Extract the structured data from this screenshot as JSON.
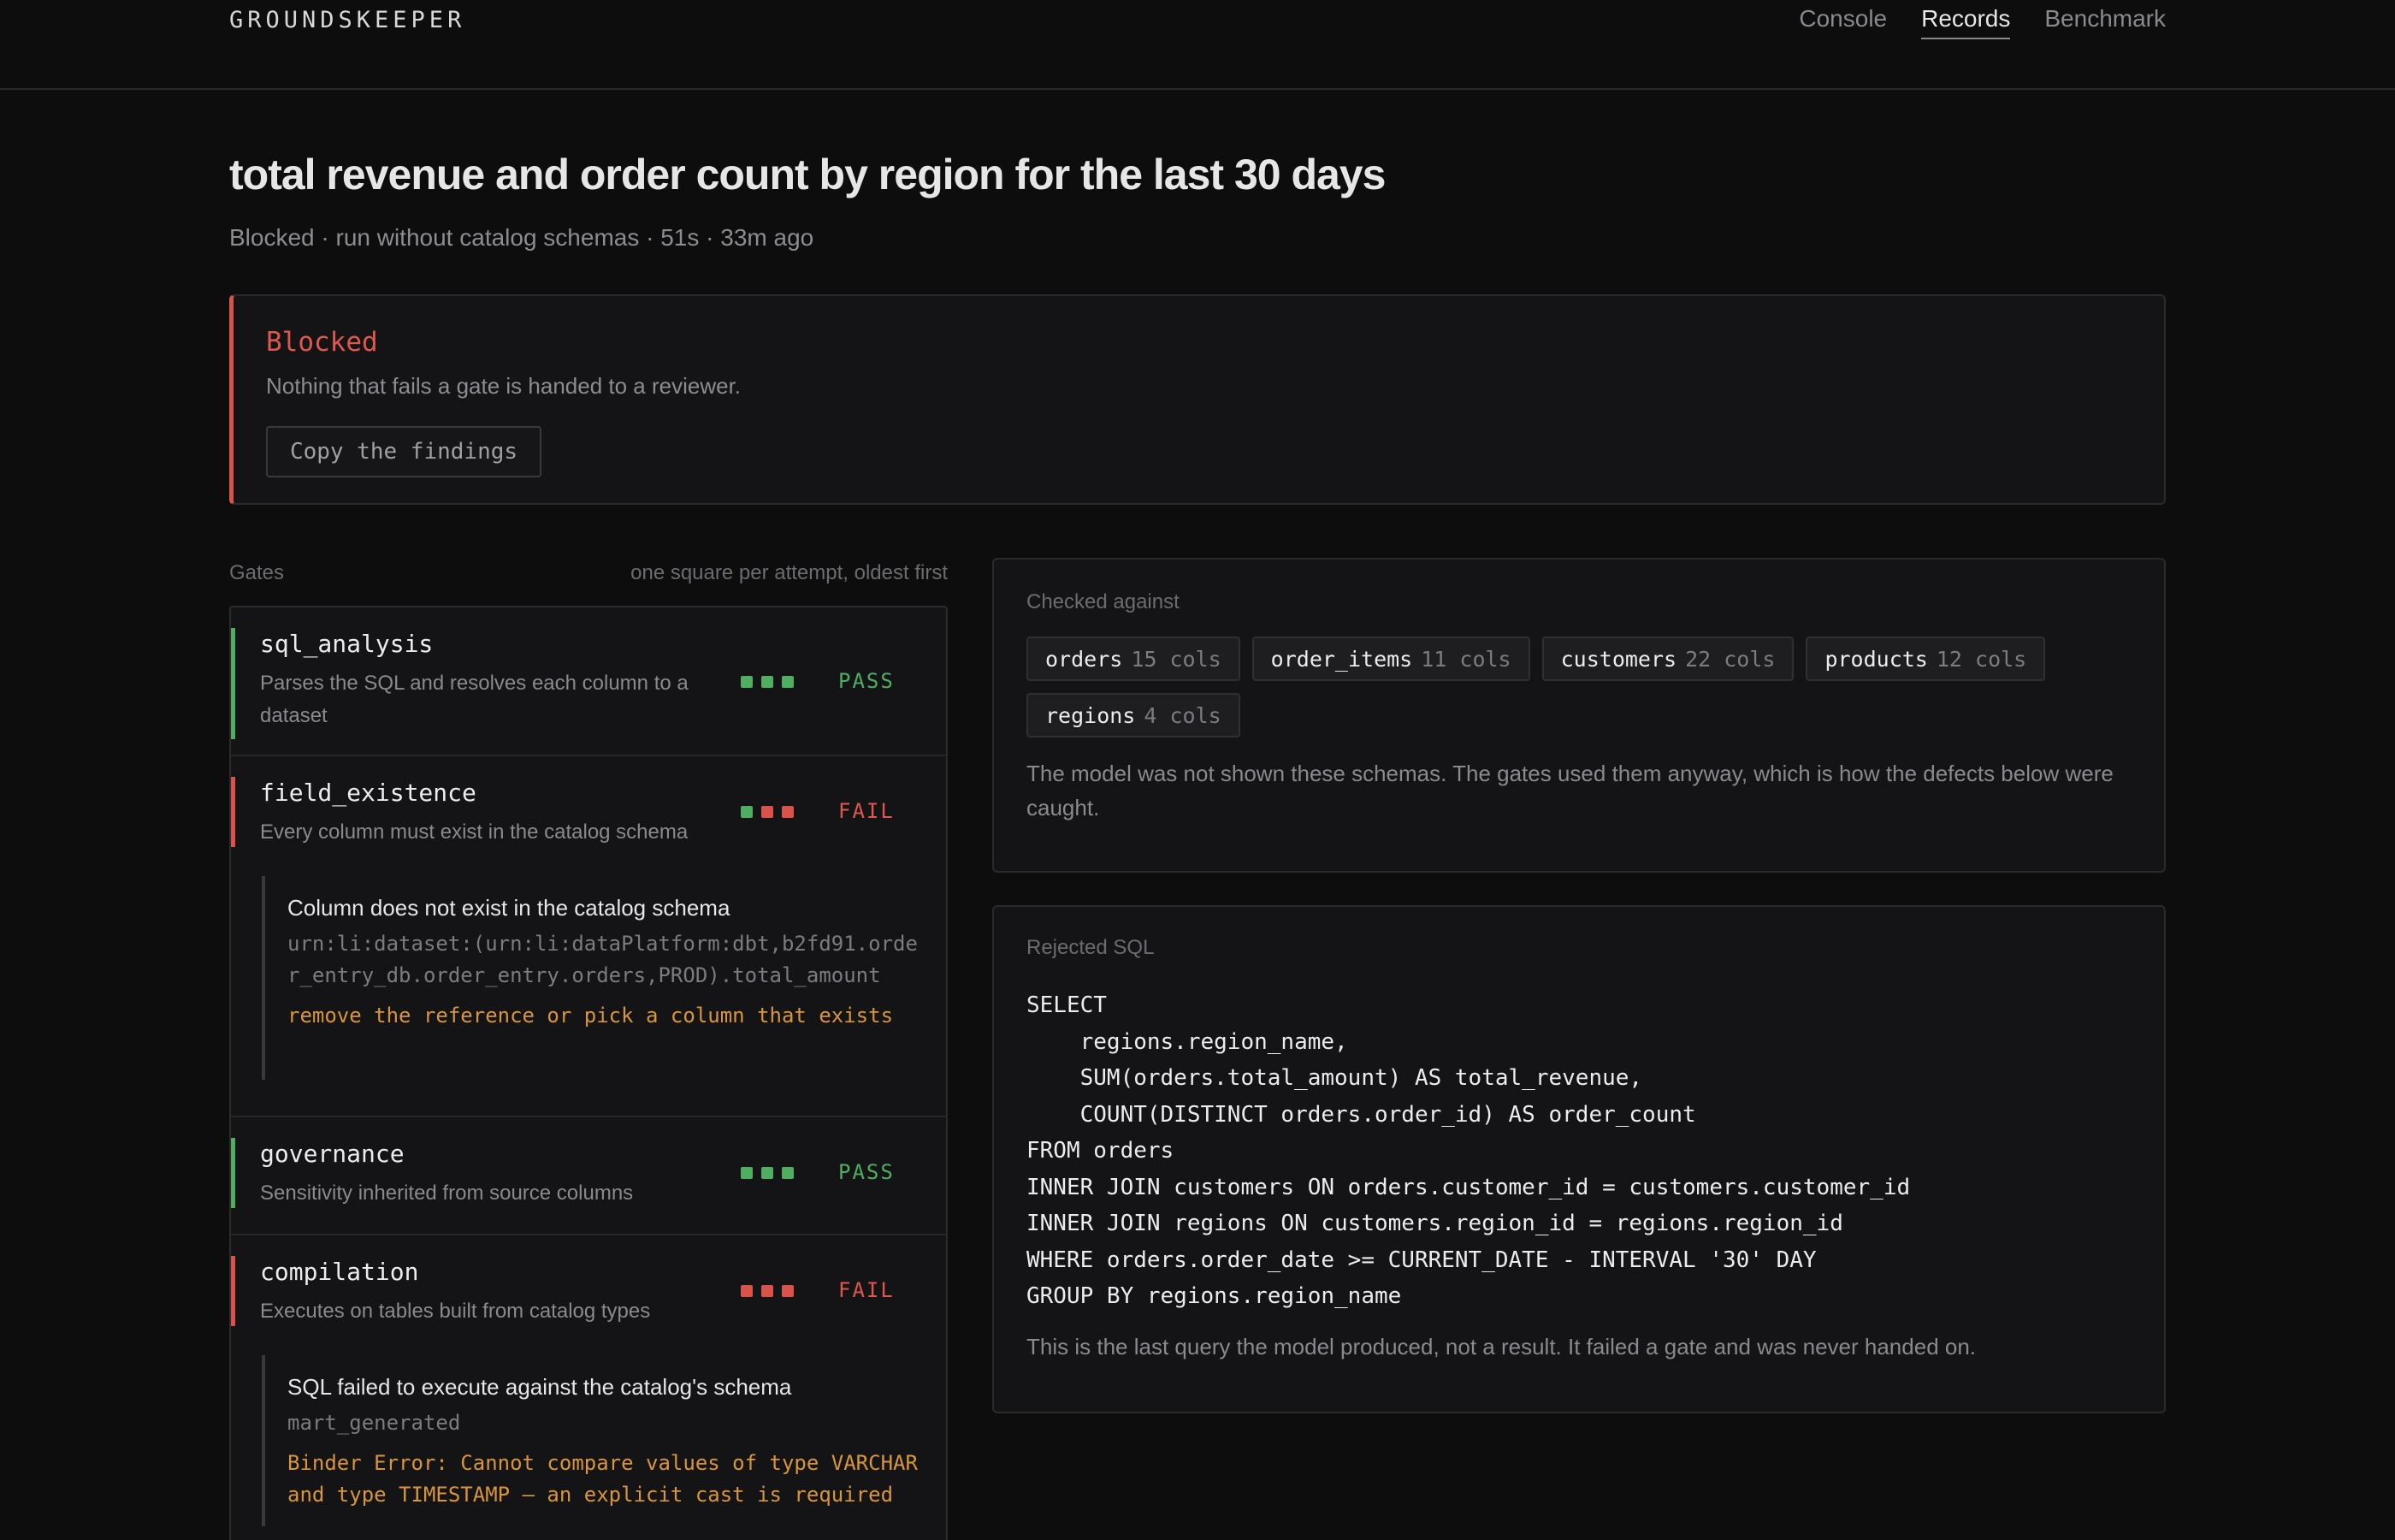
{
  "app": {
    "brand": "GROUNDSKEEPER",
    "nav": [
      "Console",
      "Records",
      "Benchmark"
    ],
    "active_nav": "Records"
  },
  "header": {
    "title": "total revenue and order count by region for the last 30 days",
    "subtitle": "Blocked · run without catalog schemas · 51s · 33m ago"
  },
  "banner": {
    "title": "Blocked",
    "text": "Nothing that fails a gate is handed to a reviewer.",
    "button": "Copy the findings",
    "accent": "#d9534a"
  },
  "gates": {
    "label": "Gates",
    "hint": "one square per attempt, oldest first",
    "items": [
      {
        "name": "sql_analysis",
        "desc": "Parses the SQL and resolves each column to a dataset",
        "attempts": [
          "pass",
          "pass",
          "pass"
        ],
        "status": "PASS"
      },
      {
        "name": "field_existence",
        "desc": "Every column must exist in the catalog schema",
        "attempts": [
          "pass",
          "fail",
          "fail"
        ],
        "status": "FAIL",
        "finding": {
          "title": "Column does not exist in the catalog schema",
          "ref": "urn:li:dataset:(urn:li:dataPlatform:dbt,b2fd91.order_entry_db.order_entry.orders,PROD).total_amount",
          "fix": "remove the reference or pick a column that exists"
        }
      },
      {
        "name": "governance",
        "desc": "Sensitivity inherited from source columns",
        "attempts": [
          "pass",
          "pass",
          "pass"
        ],
        "status": "PASS"
      },
      {
        "name": "compilation",
        "desc": "Executes on tables built from catalog types",
        "attempts": [
          "fail",
          "fail",
          "fail"
        ],
        "status": "FAIL",
        "finding": {
          "title": "SQL failed to execute against the catalog's schema",
          "ref": "mart_generated",
          "fix": "Binder Error: Cannot compare values of type VARCHAR and type TIMESTAMP — an explicit cast is required"
        }
      }
    ],
    "colors": {
      "pass": "#4fae62",
      "fail": "#d9534a"
    }
  },
  "checked": {
    "label": "Checked against",
    "tables": [
      {
        "name": "orders",
        "cols": "15 cols"
      },
      {
        "name": "order_items",
        "cols": "11 cols"
      },
      {
        "name": "customers",
        "cols": "22 cols"
      },
      {
        "name": "products",
        "cols": "12 cols"
      },
      {
        "name": "regions",
        "cols": "4 cols"
      }
    ],
    "note": "The model was not shown these schemas. The gates used them anyway, which is how the defects below were caught."
  },
  "rejected": {
    "label": "Rejected SQL",
    "lines": [
      "SELECT",
      "    regions.region_name,",
      "    SUM(orders.total_amount) AS total_revenue,",
      "    COUNT(DISTINCT orders.order_id) AS order_count",
      "FROM orders",
      "INNER JOIN customers ON orders.customer_id = customers.customer_id",
      "INNER JOIN regions ON customers.region_id = regions.region_id",
      "WHERE orders.order_date >= CURRENT_DATE - INTERVAL '30' DAY",
      "GROUP BY regions.region_name"
    ],
    "note": "This is the last query the model produced, not a result. It failed a gate and was never handed on."
  }
}
